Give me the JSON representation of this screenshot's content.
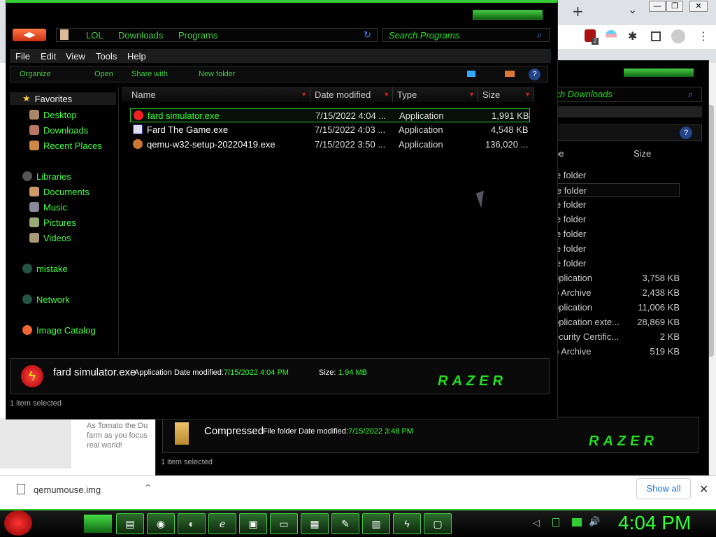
{
  "chrome": {
    "new_tab": "+",
    "tab_list": "⌄",
    "minimize": "—",
    "restore": "❐",
    "close": "✕",
    "ext_badge": "2",
    "page_text": "As Tomato the Du farm as you focus real world!",
    "download_file": "qemumouse.img",
    "show_all": "Show all"
  },
  "main_window": {
    "breadcrumb": [
      "LOL",
      "Downloads",
      "Programs"
    ],
    "search_placeholder": "Search Programs",
    "menu": [
      "File",
      "Edit",
      "View",
      "Tools",
      "Help"
    ],
    "toolbar": {
      "organize": "Organize",
      "open": "Open",
      "share": "Share with",
      "new_folder": "New folder",
      "help": "?"
    },
    "sidebar": {
      "favorites": "Favorites",
      "favorites_items": [
        "Desktop",
        "Downloads",
        "Recent Places"
      ],
      "libraries": "Libraries",
      "library_items": [
        "Documents",
        "Music",
        "Pictures",
        "Videos"
      ],
      "mistake": "mistake",
      "network": "Network",
      "image_catalog": "Image Catalog"
    },
    "columns": {
      "name": "Name",
      "date": "Date modified",
      "type": "Type",
      "size": "Size"
    },
    "files": [
      {
        "name": "fard simulator.exe",
        "date": "7/15/2022 4:04 ...",
        "type": "Application",
        "size": "1,991 KB"
      },
      {
        "name": "Fard The Game.exe",
        "date": "7/15/2022 4:03 ...",
        "type": "Application",
        "size": "4,548 KB"
      },
      {
        "name": "qemu-w32-setup-20220419.exe",
        "date": "7/15/2022 3:50 ...",
        "type": "Application",
        "size": "136,020 ..."
      }
    ],
    "details": {
      "name": "fard simulator.exe",
      "type": "Application",
      "date_label": "Date modified:",
      "date": "7/15/2022 4:04 PM",
      "size_label": "Size:",
      "size": "1.94 MB"
    },
    "brand": "RAZER",
    "status": "1 item selected"
  },
  "back_window": {
    "search_placeholder": "rch Downloads",
    "columns": {
      "type": "pe",
      "size": "Size"
    },
    "rows": [
      {
        "type": "le folder",
        "size": ""
      },
      {
        "type": "le folder",
        "size": ""
      },
      {
        "type": "le folder",
        "size": ""
      },
      {
        "type": "le folder",
        "size": ""
      },
      {
        "type": "le folder",
        "size": ""
      },
      {
        "type": "le folder",
        "size": ""
      },
      {
        "type": "le folder",
        "size": ""
      },
      {
        "type": "pplication",
        "size": "3,758 KB"
      },
      {
        "type": "p Archive",
        "size": "2,438 KB"
      },
      {
        "type": "pplication",
        "size": "11,006 KB"
      },
      {
        "type": "pplication exte...",
        "size": "28,869 KB"
      },
      {
        "type": "ecurity Certific...",
        "size": "2 KB"
      },
      {
        "type": "p Archive",
        "size": "519 KB"
      }
    ],
    "details": {
      "name": "Compressed",
      "type": "File folder",
      "date_label": "Date modified:",
      "date": "7/15/2022 3:48 PM"
    },
    "brand": "RAZER",
    "status": "1 item selected"
  },
  "taskbar": {
    "clock": "4:04 PM"
  }
}
